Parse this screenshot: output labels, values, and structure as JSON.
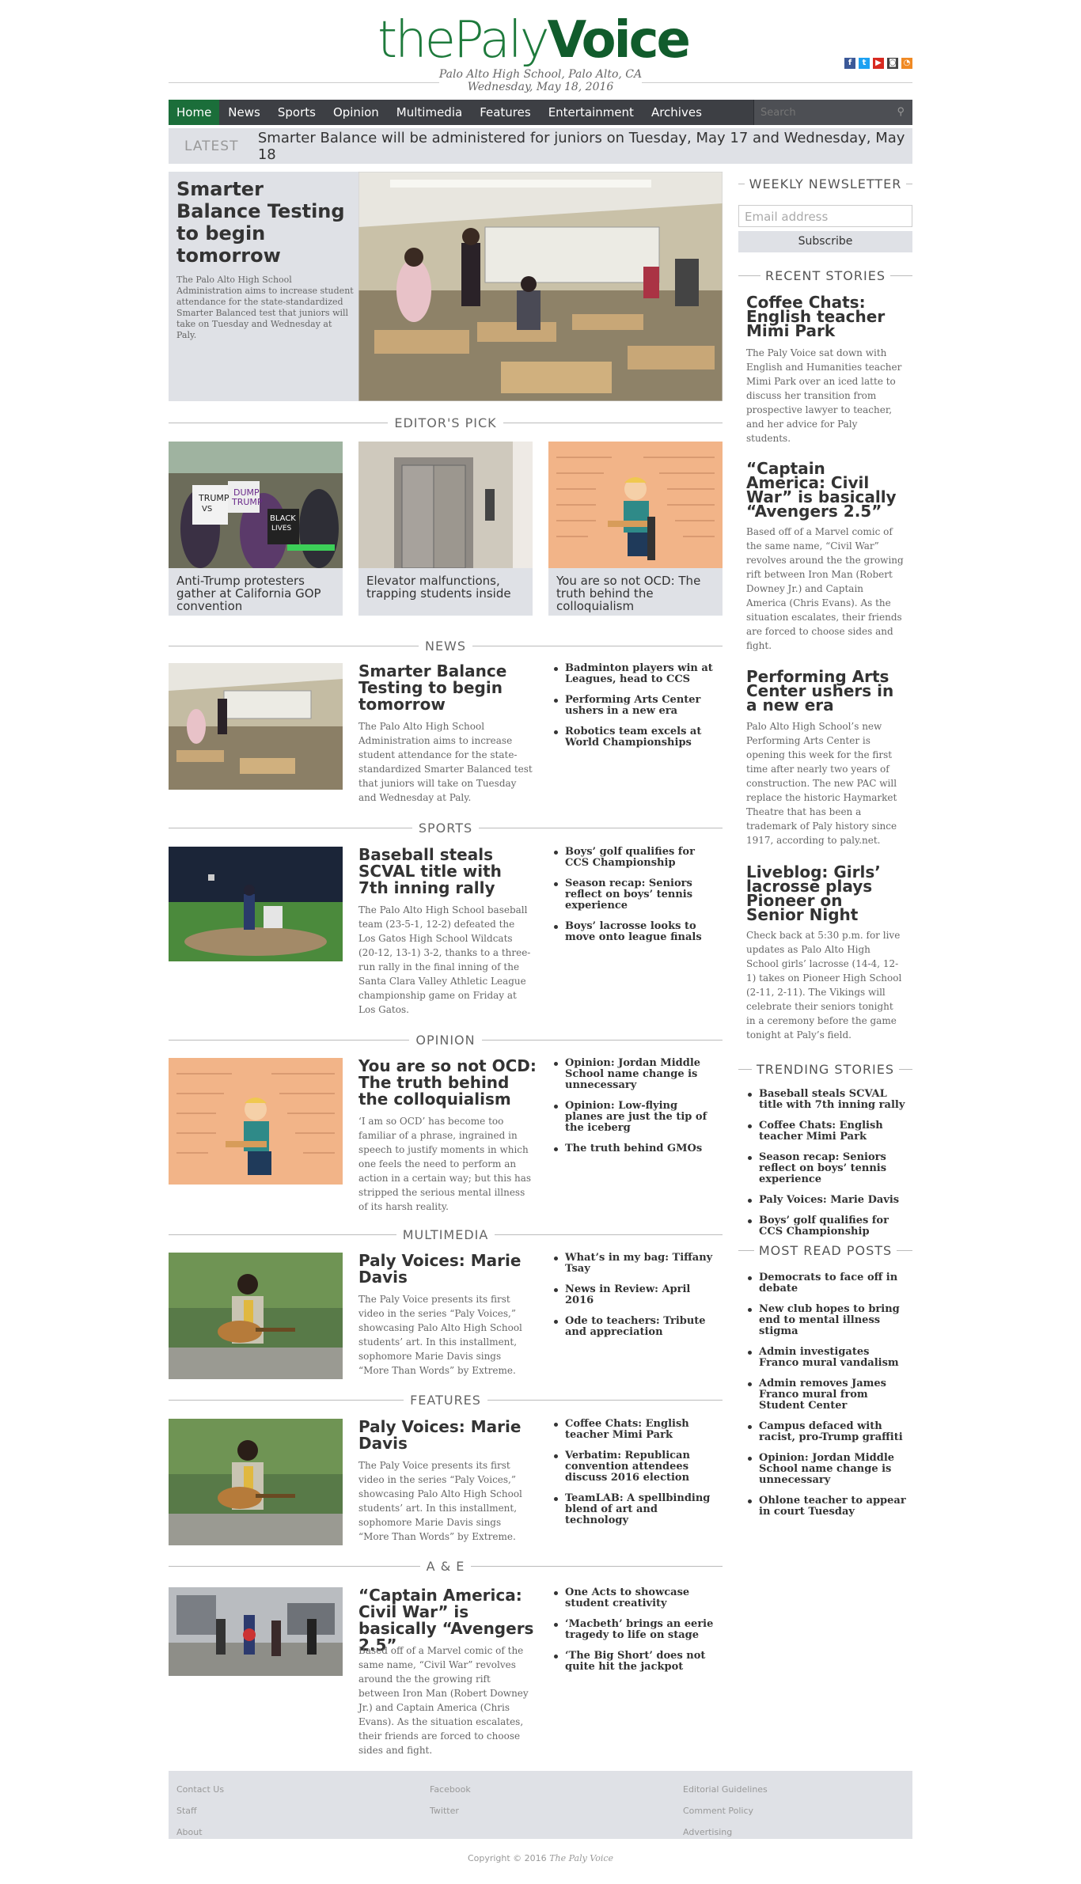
{
  "masthead": {
    "logo_the": "the",
    "logo_paly": "Paly",
    "logo_voice": "Voice",
    "location": "Palo Alto High School, Palo Alto, CA",
    "date": "Wednesday, May 18, 2016"
  },
  "social": [
    "facebook-icon",
    "twitter-icon",
    "youtube-icon",
    "instagram-icon",
    "rss-icon"
  ],
  "nav": {
    "items": [
      "Home",
      "News",
      "Sports",
      "Opinion",
      "Multimedia",
      "Features",
      "Entertainment",
      "Archives"
    ],
    "search_placeholder": "Search"
  },
  "latest": {
    "label": "LATEST",
    "text": "Smarter Balance will be administered for juniors on Tuesday, May 17 and Wednesday, May 18"
  },
  "hero": {
    "title": "Smarter Balance Testing to begin tomorrow",
    "body": "The Palo Alto High School Administration aims to increase student attendance for the state-standardized Smarter Balanced test that juniors will take on Tuesday and Wednesday at Paly."
  },
  "editors_pick": {
    "heading": "EDITOR'S PICK",
    "cards": [
      "Anti-Trump protesters gather at California GOP convention",
      "Elevator malfunctions, trapping students inside",
      "You are so not OCD: The truth behind the colloquialism"
    ]
  },
  "sections": [
    {
      "heading": "NEWS",
      "title": "Smarter Balance Testing to begin tomorrow",
      "body": "The Palo Alto High School Administration aims to increase student attendance for the state-standardized Smarter Balanced test that juniors will take on Tuesday and Wednesday at Paly.",
      "links": [
        "Badminton players win at Leagues, head to CCS",
        "Performing Arts Center ushers in a new era",
        "Robotics team excels at World Championships"
      ]
    },
    {
      "heading": "SPORTS",
      "title": "Baseball steals SCVAL title with 7th inning rally",
      "body": "The Palo Alto High School baseball team (23-5-1, 12-2) defeated the Los Gatos High School Wildcats (20-12, 13-1) 3-2, thanks to a three-run rally in the final inning of the Santa Clara Valley Athletic League championship game on Friday at Los Gatos.",
      "links": [
        "Boys’ golf qualifies for CCS Championship",
        "Season recap: Seniors reflect on boys’ tennis experience",
        "Boys’ lacrosse looks to move onto league finals"
      ]
    },
    {
      "heading": "OPINION",
      "title": "You are so not OCD: The truth behind the colloquialism",
      "body": "‘I am so OCD’ has become too familiar of a phrase, ingrained in speech to justify moments in which one feels the need to perform an action in a certain way; but this has stripped the serious mental illness of its harsh reality.",
      "links": [
        "Opinion: Jordan Middle School name change is unnecessary",
        "Opinion: Low-flying planes are just the tip of the iceberg",
        "The truth behind GMOs"
      ]
    },
    {
      "heading": "MULTIMEDIA",
      "title": "Paly Voices: Marie Davis",
      "body": "The Paly Voice presents its first video in the series “Paly Voices,” showcasing Palo Alto High School students’ art. In this installment, sophomore Marie Davis sings “More Than Words” by Extreme.",
      "links": [
        "What’s in my bag: Tiffany Tsay",
        "News in Review: April 2016",
        "Ode to teachers: Tribute and appreciation"
      ]
    },
    {
      "heading": "FEATURES",
      "title": "Paly Voices: Marie Davis",
      "body": "The Paly Voice presents its first video in the series “Paly Voices,” showcasing Palo Alto High School students’ art. In this installment, sophomore Marie Davis sings “More Than Words” by Extreme.",
      "links": [
        "Coffee Chats: English teacher Mimi Park",
        "Verbatim: Republican convention attendees discuss 2016 election",
        "TeamLAB: A spellbinding blend of art and technology"
      ]
    },
    {
      "heading": "A & E",
      "title": "“Captain America: Civil War” is basically “Avengers 2.5”",
      "body": "Based off of a Marvel comic of the same name, “Civil War” revolves around the the growing rift between Iron Man (Robert Downey Jr.) and Captain America (Chris Evans). As the situation escalates, their friends are forced to choose sides and fight.",
      "links": [
        "One Acts to showcase student creativity",
        "‘Macbeth’ brings an eerie tragedy to life on stage",
        "‘The Big Short’ does not quite hit the jackpot"
      ]
    }
  ],
  "sidebar": {
    "newsletter_heading": "WEEKLY NEWSLETTER",
    "email_placeholder": "Email address",
    "subscribe": "Subscribe",
    "recent_heading": "RECENT STORIES",
    "recent": [
      {
        "title": "Coffee Chats: English teacher Mimi Park",
        "body": "The Paly Voice sat down with English and Humanities teacher Mimi Park over an iced latte to discuss her transition from prospective lawyer to teacher, and her advice for Paly students."
      },
      {
        "title": "“Captain America: Civil War” is basically “Avengers 2.5”",
        "body": "Based off of a Marvel comic of the same name, “Civil War” revolves around the the growing rift between Iron Man (Robert Downey Jr.) and Captain America (Chris Evans). As the situation escalates, their friends are forced to choose sides and fight."
      },
      {
        "title": "Performing Arts Center ushers in a new era",
        "body": "Palo Alto High School’s new Performing Arts Center is opening this week for the first time after nearly two years of construction. The new PAC will replace the historic Haymarket Theatre that has been a trademark of Paly history since 1917, according to paly.net."
      },
      {
        "title": "Liveblog: Girls’ lacrosse plays Pioneer on Senior Night",
        "body": "Check back at 5:30 p.m. for live updates as Palo Alto High School girls’ lacrosse (14-4, 12-1) takes on Pioneer High School (2-11, 2-11). The Vikings will celebrate their seniors tonight in a ceremony before the game tonight at Paly’s field."
      }
    ],
    "trending_heading": "TRENDING STORIES",
    "trending": [
      "Baseball steals SCVAL title with 7th inning rally",
      "Coffee Chats: English teacher Mimi Park",
      "Season recap: Seniors reflect on boys’ tennis experience",
      "Paly Voices: Marie Davis",
      "Boys’ golf qualifies for CCS Championship"
    ],
    "most_read_heading": "MOST READ POSTS",
    "most_read": [
      "Democrats to face off in debate",
      "New club hopes to bring end to mental illness stigma",
      "Admin investigates Franco mural vandalism",
      "Admin removes James Franco mural from Student Center",
      "Campus defaced with racist, pro-Trump graffiti",
      "Opinion: Jordan Middle School name change is unnecessary",
      "Ohlone teacher to appear in court Tuesday"
    ]
  },
  "footer": {
    "col1": [
      "Contact Us",
      "Staff",
      "About"
    ],
    "col2": [
      "Facebook",
      "Twitter"
    ],
    "col3": [
      "Editorial Guidelines",
      "Comment Policy",
      "Advertising"
    ],
    "copyright": "Copyright © 2016",
    "copyright_name": "The Paly Voice"
  },
  "colors": {
    "brand_green": "#1b6e3a",
    "nav_bg": "#3d3f44",
    "panel_bg": "#dfe1e6"
  }
}
